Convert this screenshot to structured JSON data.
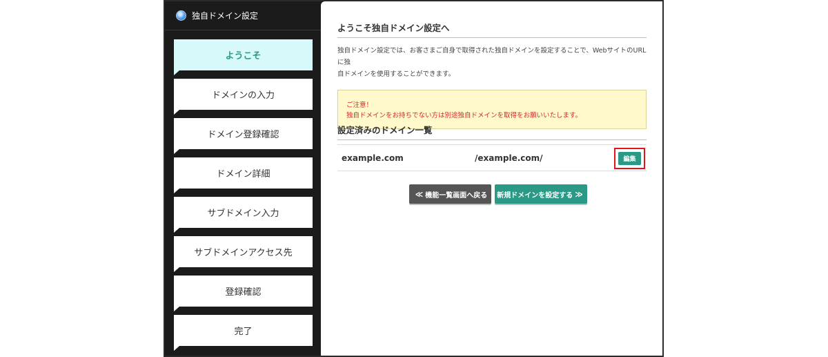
{
  "app": {
    "title": "独自ドメイン設定"
  },
  "sidebar": {
    "steps": [
      {
        "label": "ようこそ",
        "active": true
      },
      {
        "label": "ドメインの入力",
        "active": false
      },
      {
        "label": "ドメイン登録確認",
        "active": false
      },
      {
        "label": "ドメイン詳細",
        "active": false
      },
      {
        "label": "サブドメイン入力",
        "active": false
      },
      {
        "label": "サブドメインアクセス先",
        "active": false
      },
      {
        "label": "登録確認",
        "active": false
      },
      {
        "label": "完了",
        "active": false
      }
    ]
  },
  "main": {
    "welcome_title": "ようこそ独自ドメイン設定へ",
    "intro_line1": "独自ドメイン設定では、お客さまご自身で取得された独自ドメインを設定することで、WebサイトのURLに独",
    "intro_line2": "自ドメインを使用することができます。",
    "notice_title": "ご注意！",
    "notice_text": "独自ドメインをお持ちでない方は別途独自ドメインを取得をお願いいたします。",
    "list_title": "設定済みのドメイン一覧",
    "domains": [
      {
        "name": "example.com",
        "path": "/example.com/",
        "edit_label": "編集"
      }
    ],
    "back_button": "機能一覧画面へ戻る",
    "new_button": "新規ドメインを設定する"
  },
  "colors": {
    "accent": "#2a9a86",
    "active_step_bg": "#d8f9f9",
    "notice_bg": "#fff9cc",
    "notice_text": "#d12a2a",
    "highlight": "#e0141b"
  }
}
